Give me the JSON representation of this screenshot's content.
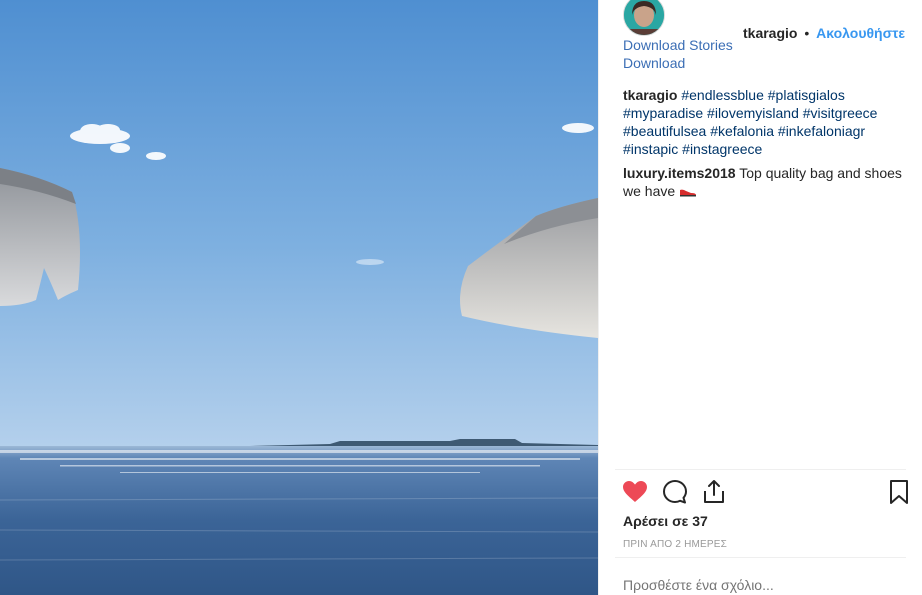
{
  "post": {
    "username": "tkaragio",
    "separator": "•",
    "follow_label": "Ακολουθήστε",
    "download_stories_label": "Download Stories",
    "download_label": "Download",
    "caption": {
      "username": "tkaragio",
      "hashtags": [
        "#endlessblue",
        "#platisgialos",
        "#myparadise",
        "#ilovemyisland",
        "#visitgreece",
        "#beautifulsea",
        "#kefalonia",
        "#inkefaloniagr",
        "#instapic",
        "#instagreece"
      ]
    },
    "comment": {
      "username": "luxury.items2018",
      "text": "Top quality bag and shoes we have"
    },
    "likes_label": "Αρέσει σε 37",
    "timestamp": "ΠΡΙΝ ΑΠΟ 2 ΗΜΕΡΕΣ",
    "add_comment_placeholder": "Προσθέστε ένα σχόλιο..."
  },
  "icons": {
    "like": "heart-icon",
    "comment": "comment-icon",
    "share": "share-icon",
    "save": "bookmark-icon"
  },
  "colors": {
    "like_red": "#ed4956",
    "follow_blue": "#3897f0",
    "hashtag_blue": "#003569",
    "link_blue": "#3b6eb5"
  }
}
